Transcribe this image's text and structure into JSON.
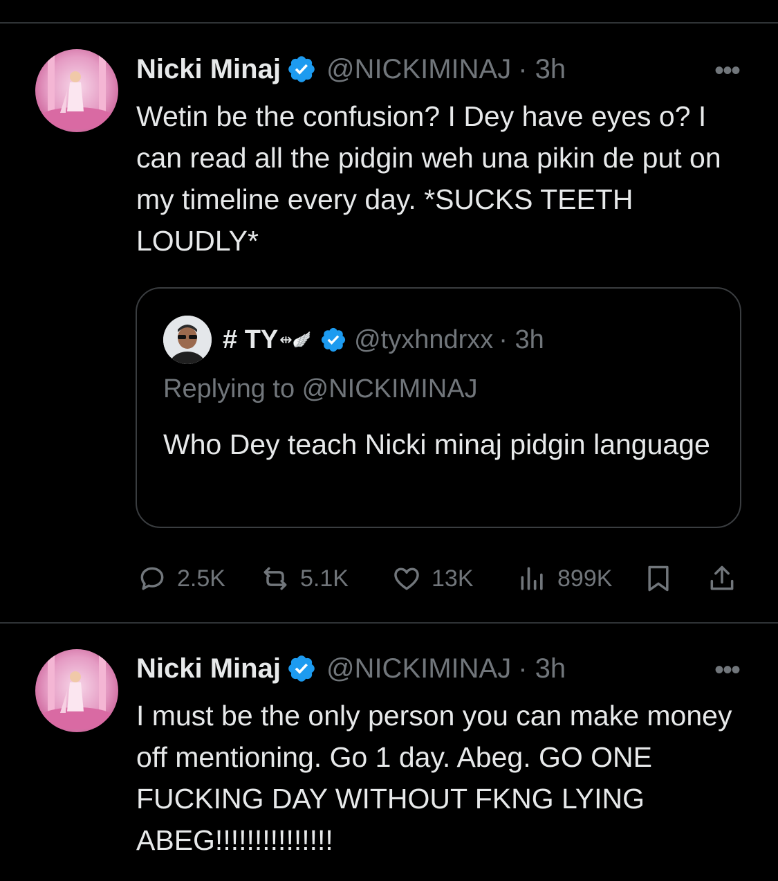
{
  "tweets": [
    {
      "author": {
        "name": "Nicki Minaj",
        "handle": "@NICKIMINAJ",
        "time": "· 3h"
      },
      "text": "Wetin be the confusion? I Dey have eyes o? I can read all the pidgin weh una pikin de put on my timeline every day. *SUCKS TEETH LOUDLY*",
      "quote": {
        "author": {
          "name": "# TY",
          "emoji": "⇹🪽",
          "handle": "@tyxhndrxx",
          "time": "· 3h"
        },
        "replying_label": "Replying to @NICKIMINAJ",
        "text": "Who Dey teach Nicki minaj pidgin language"
      },
      "actions": {
        "replies": "2.5K",
        "retweets": "5.1K",
        "likes": "13K",
        "views": "899K"
      }
    },
    {
      "author": {
        "name": "Nicki Minaj",
        "handle": "@NICKIMINAJ",
        "time": "· 3h"
      },
      "text": "I must be the only person you can make money off mentioning. Go 1 day. Abeg. GO ONE FUCKING DAY WITHOUT FKNG LYING ABEG!!!!!!!!!!!!!!!"
    }
  ],
  "more_label": "•••",
  "colors": {
    "accent": "#1d9bf0",
    "muted": "#71767b",
    "text": "#e7e9ea",
    "border": "#2f3336"
  },
  "icons": [
    "verified-badge-icon",
    "reply-icon",
    "retweet-icon",
    "like-icon",
    "views-icon",
    "bookmark-icon",
    "share-icon",
    "more-icon"
  ]
}
